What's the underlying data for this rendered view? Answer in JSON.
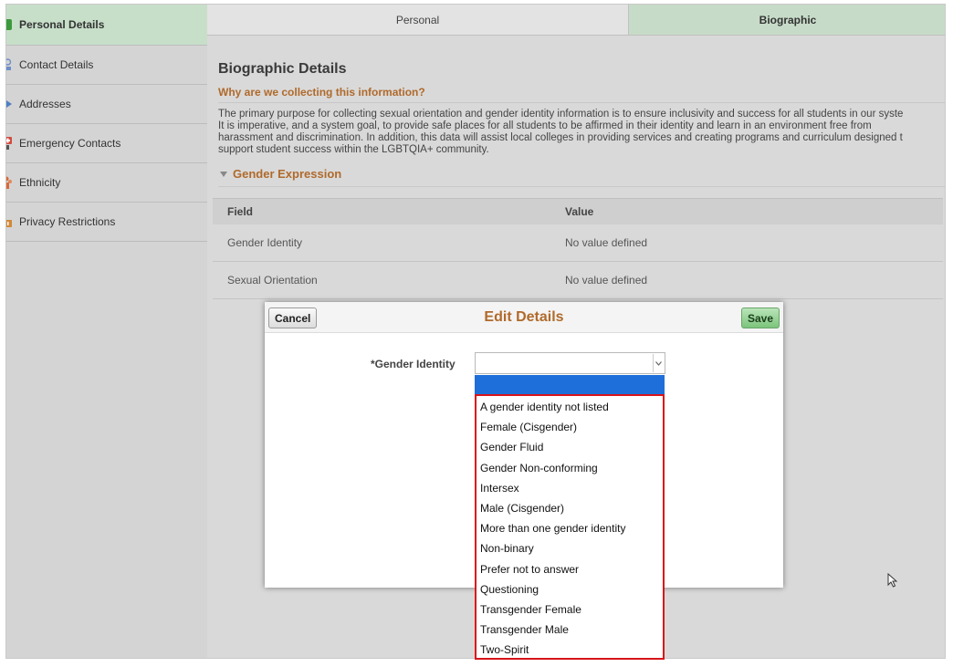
{
  "sidebar": {
    "items": [
      {
        "label": "Personal Details",
        "icon": "personal-details-icon",
        "color": "#3c9a3c",
        "active": true
      },
      {
        "label": "Contact Details",
        "icon": "contact-icon",
        "color": "#6d8fc7",
        "active": false
      },
      {
        "label": "Addresses",
        "icon": "address-icon",
        "color": "#4f7fc2",
        "active": false
      },
      {
        "label": "Emergency Contacts",
        "icon": "emergency-icon",
        "color": "#d24b3e",
        "active": false
      },
      {
        "label": "Ethnicity",
        "icon": "ethnicity-icon",
        "color": "#d86a3a",
        "active": false
      },
      {
        "label": "Privacy Restrictions",
        "icon": "privacy-icon",
        "color": "#d08a3a",
        "active": false
      }
    ]
  },
  "tabs": {
    "personal": "Personal",
    "biographic": "Biographic"
  },
  "content": {
    "title": "Biographic Details",
    "why": "Why are we collecting this information?",
    "purpose_lines": [
      "The primary purpose for collecting sexual orientation and gender identity information is to ensure inclusivity and success for all students in our syste",
      "It is imperative, and a system goal, to provide safe places for all students to be affirmed in their identity and learn in an environment free from",
      "harassment and discrimination. In addition, this data will assist local colleges in providing services and creating programs and curriculum designed t",
      "support student success within the LGBTQIA+ community."
    ],
    "section": "Gender Expression",
    "grid": {
      "col_field": "Field",
      "col_value": "Value",
      "rows": [
        {
          "field": "Gender Identity",
          "value": "No value defined"
        },
        {
          "field": "Sexual Orientation",
          "value": "No value defined"
        }
      ]
    }
  },
  "modal": {
    "title": "Edit Details",
    "cancel": "Cancel",
    "save": "Save",
    "field_label": "*Gender Identity",
    "selected_value": ""
  },
  "dropdown": {
    "options": [
      "A gender identity not listed",
      "Female (Cisgender)",
      "Gender Fluid",
      "Gender Non-conforming",
      "Intersex",
      "Male (Cisgender)",
      "More than one gender identity",
      "Non-binary",
      "Prefer not to answer",
      "Questioning",
      "Transgender Female",
      "Transgender Male",
      "Two-Spirit"
    ]
  },
  "colors": {
    "accent": "#b06a2b",
    "active_tab": "#c7dcc8",
    "highlight": "#d8141a",
    "selection": "#1e6fd9"
  }
}
